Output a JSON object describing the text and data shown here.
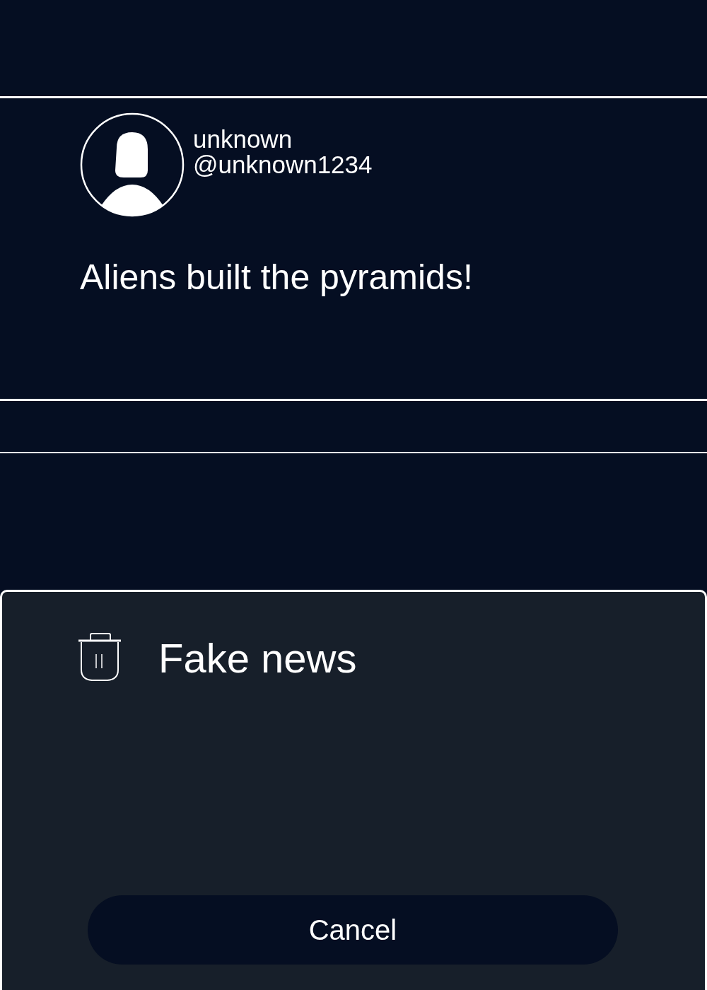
{
  "post": {
    "display_name": "unknown",
    "handle": "@unknown1234",
    "text": "Aliens built the pyramids!"
  },
  "sheet": {
    "actions": [
      {
        "label": "Fake news"
      }
    ],
    "cancel": "Cancel"
  }
}
